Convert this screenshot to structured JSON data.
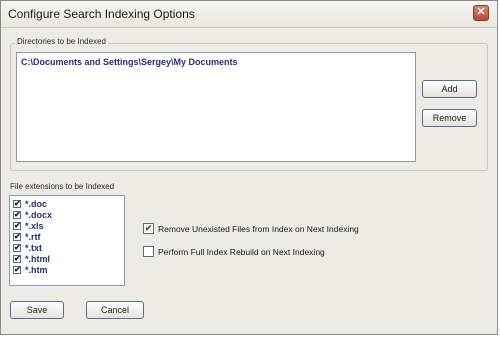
{
  "window": {
    "title": "Configure Search Indexing Options",
    "close_glyph": "✕"
  },
  "directories": {
    "label": "Directories to be Indexed",
    "items": [
      "C:\\Documents and Settings\\Sergey\\My Documents"
    ],
    "add_label": "Add",
    "remove_label": "Remove"
  },
  "extensions": {
    "label": "File extensions to be Indexed",
    "check_glyph": "✔",
    "items": [
      {
        "ext": "*.doc",
        "checked": true
      },
      {
        "ext": "*.docx",
        "checked": true
      },
      {
        "ext": "*.xls",
        "checked": true
      },
      {
        "ext": "*.rtf",
        "checked": true
      },
      {
        "ext": "*.txt",
        "checked": true
      },
      {
        "ext": "*.html",
        "checked": true
      },
      {
        "ext": "*.htm",
        "checked": true
      }
    ]
  },
  "options": {
    "check_glyph": "✔",
    "remove_unexisted": {
      "label": "Remove Unexisted Files from Index on Next Indexing",
      "checked": true
    },
    "full_rebuild": {
      "label": "Perform Full Index Rebuild on Next Indexing",
      "checked": false
    }
  },
  "footer": {
    "save_label": "Save",
    "cancel_label": "Cancel"
  }
}
